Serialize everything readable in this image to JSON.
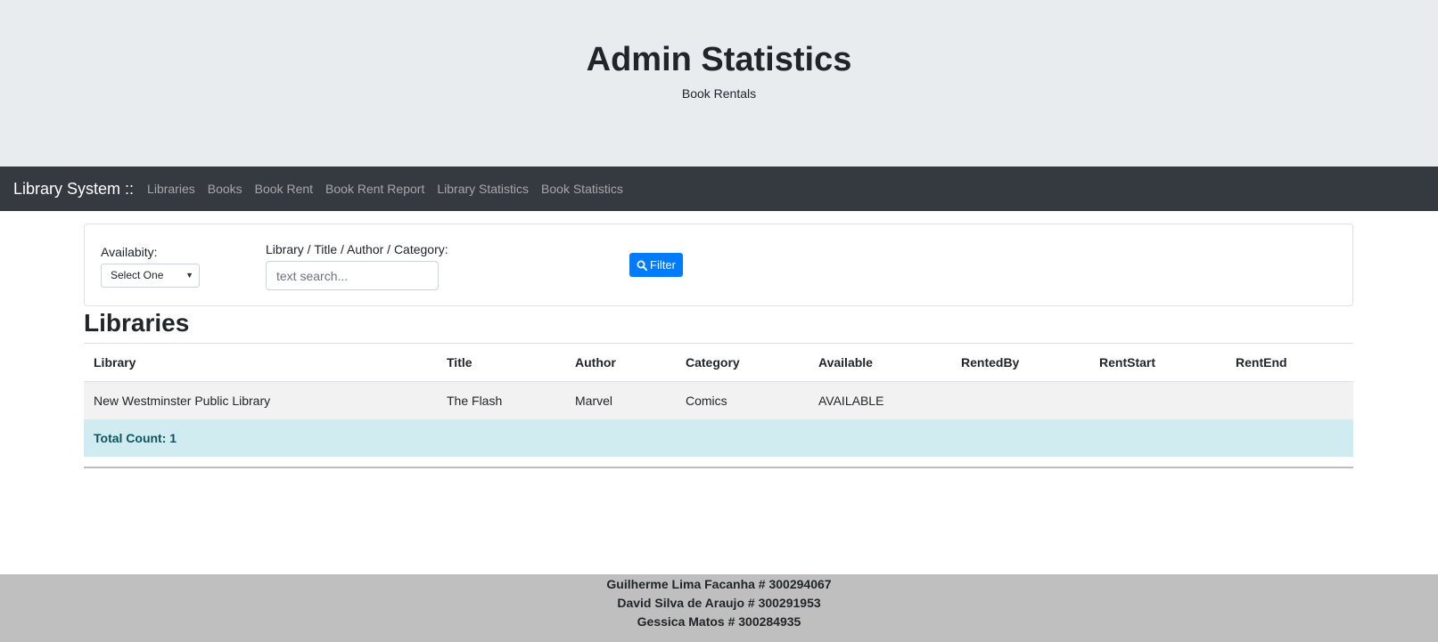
{
  "header": {
    "title": "Admin Statistics",
    "subtitle": "Book Rentals"
  },
  "navbar": {
    "brand": "Library System ::",
    "links": [
      {
        "label": "Libraries"
      },
      {
        "label": "Books"
      },
      {
        "label": "Book Rent"
      },
      {
        "label": "Book Rent Report"
      },
      {
        "label": "Library Statistics"
      },
      {
        "label": "Book Statistics"
      }
    ]
  },
  "filter": {
    "availability_label": "Availabity:",
    "availability_value": "Select One",
    "search_label": "Library / Title / Author / Category:",
    "search_placeholder": "text search...",
    "button_label": "Filter",
    "button_icon": "search-icon"
  },
  "section": {
    "title": "Libraries"
  },
  "table": {
    "columns": [
      "Library",
      "Title",
      "Author",
      "Category",
      "Available",
      "RentedBy",
      "RentStart",
      "RentEnd"
    ],
    "rows": [
      [
        "New Westminster Public Library",
        "The Flash",
        "Marvel",
        "Comics",
        "AVAILABLE",
        "",
        "",
        ""
      ]
    ],
    "total_label": "Total Count: 1"
  },
  "footer": {
    "lines": [
      "Guilherme Lima Facanha # 300294067",
      "David Silva de Araujo # 300291953",
      "Gessica Matos # 300284935"
    ]
  },
  "colors": {
    "primary": "#007bff",
    "navbar": "#343a40",
    "jumbotron": "#e9ecef",
    "info_row": "#d1ecf1",
    "footer": "#bfbfbf"
  }
}
